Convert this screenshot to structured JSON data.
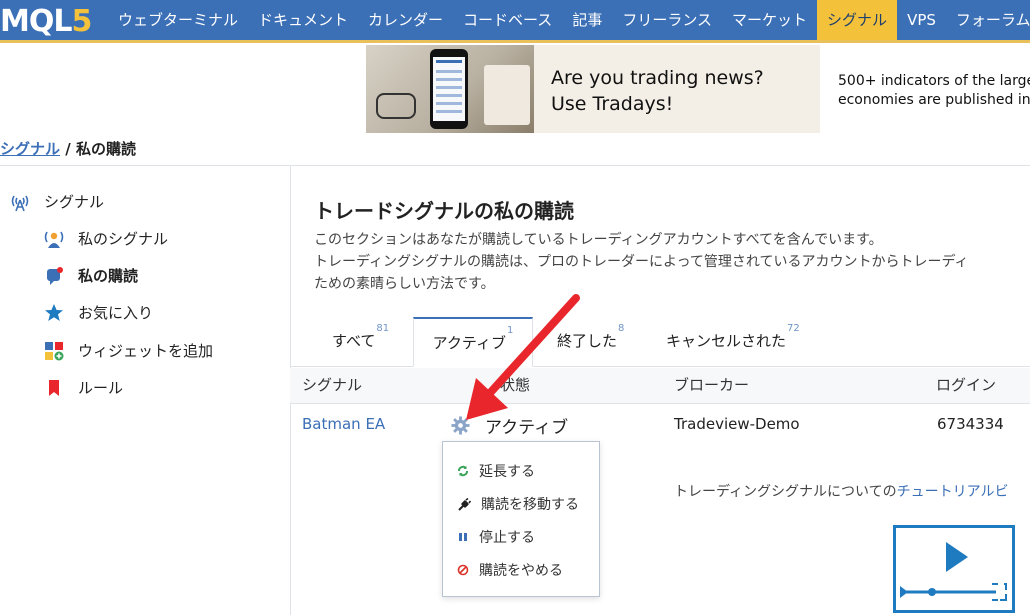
{
  "nav": {
    "logo_main": "MQL",
    "logo_digit": "5",
    "items": [
      "ウェブターミナル",
      "ドキュメント",
      "カレンダー",
      "コードベース",
      "記事",
      "フリーランス",
      "マーケット",
      "シグナル",
      "VPS",
      "フォーラム"
    ],
    "active_index": 7
  },
  "banner": {
    "line1": "Are you trading news?",
    "line2": "Use Tradays!"
  },
  "promo": {
    "line1": "500+ indicators of the larges",
    "line2": "economies are published in r"
  },
  "breadcrumb": {
    "parent": "シグナル",
    "separator": "/",
    "current": "私の購読"
  },
  "sidebar": {
    "items": [
      {
        "label": "シグナル",
        "icon": "signal-antenna-icon"
      },
      {
        "label": "私のシグナル",
        "icon": "user-signal-icon"
      },
      {
        "label": "私の購読",
        "icon": "subscription-icon",
        "active": true
      },
      {
        "label": "お気に入り",
        "icon": "star-icon"
      },
      {
        "label": "ウィジェットを追加",
        "icon": "widget-icon"
      },
      {
        "label": "ルール",
        "icon": "bookmark-icon"
      }
    ]
  },
  "main": {
    "title": "トレードシグナルの私の購読",
    "desc1": "このセクションはあなたが購読しているトレーディングアカウントすべてを含んでいます。",
    "desc2": "トレーディングシグナルの購読は、プロのトレーダーによって管理されているアカウントからトレーディ",
    "desc3": "ための素晴らしい方法です。"
  },
  "tabs": [
    {
      "label": "すべて",
      "count": "81"
    },
    {
      "label": "アクティブ",
      "count": "1"
    },
    {
      "label": "終了した",
      "count": "8"
    },
    {
      "label": "キャンセルされた",
      "count": "72"
    }
  ],
  "table": {
    "headers": {
      "signal": "シグナル",
      "status": "状態",
      "broker": "ブローカー",
      "login": "ログイン"
    },
    "row": {
      "signal": "Batman EA",
      "status": "アクティブ",
      "broker": "Tradeview-Demo",
      "login": "6734334"
    }
  },
  "dropdown": {
    "items": [
      {
        "label": "延長する",
        "icon": "renew-icon",
        "color": "#3aa55a"
      },
      {
        "label": "購読を移動する",
        "icon": "plug-icon",
        "color": "#222222"
      },
      {
        "label": "停止する",
        "icon": "pause-icon",
        "color": "#3b6fb6"
      },
      {
        "label": "購読をやめる",
        "icon": "cancel-icon",
        "color": "#d9342b"
      }
    ]
  },
  "tutorial": {
    "text": "トレーディングシグナルについての",
    "link": "チュートリアルビ"
  },
  "colors": {
    "nav_bg": "#3b6fb6",
    "nav_active": "#f3c13a",
    "link": "#3b6fb6",
    "arrow": "#e8262b"
  }
}
